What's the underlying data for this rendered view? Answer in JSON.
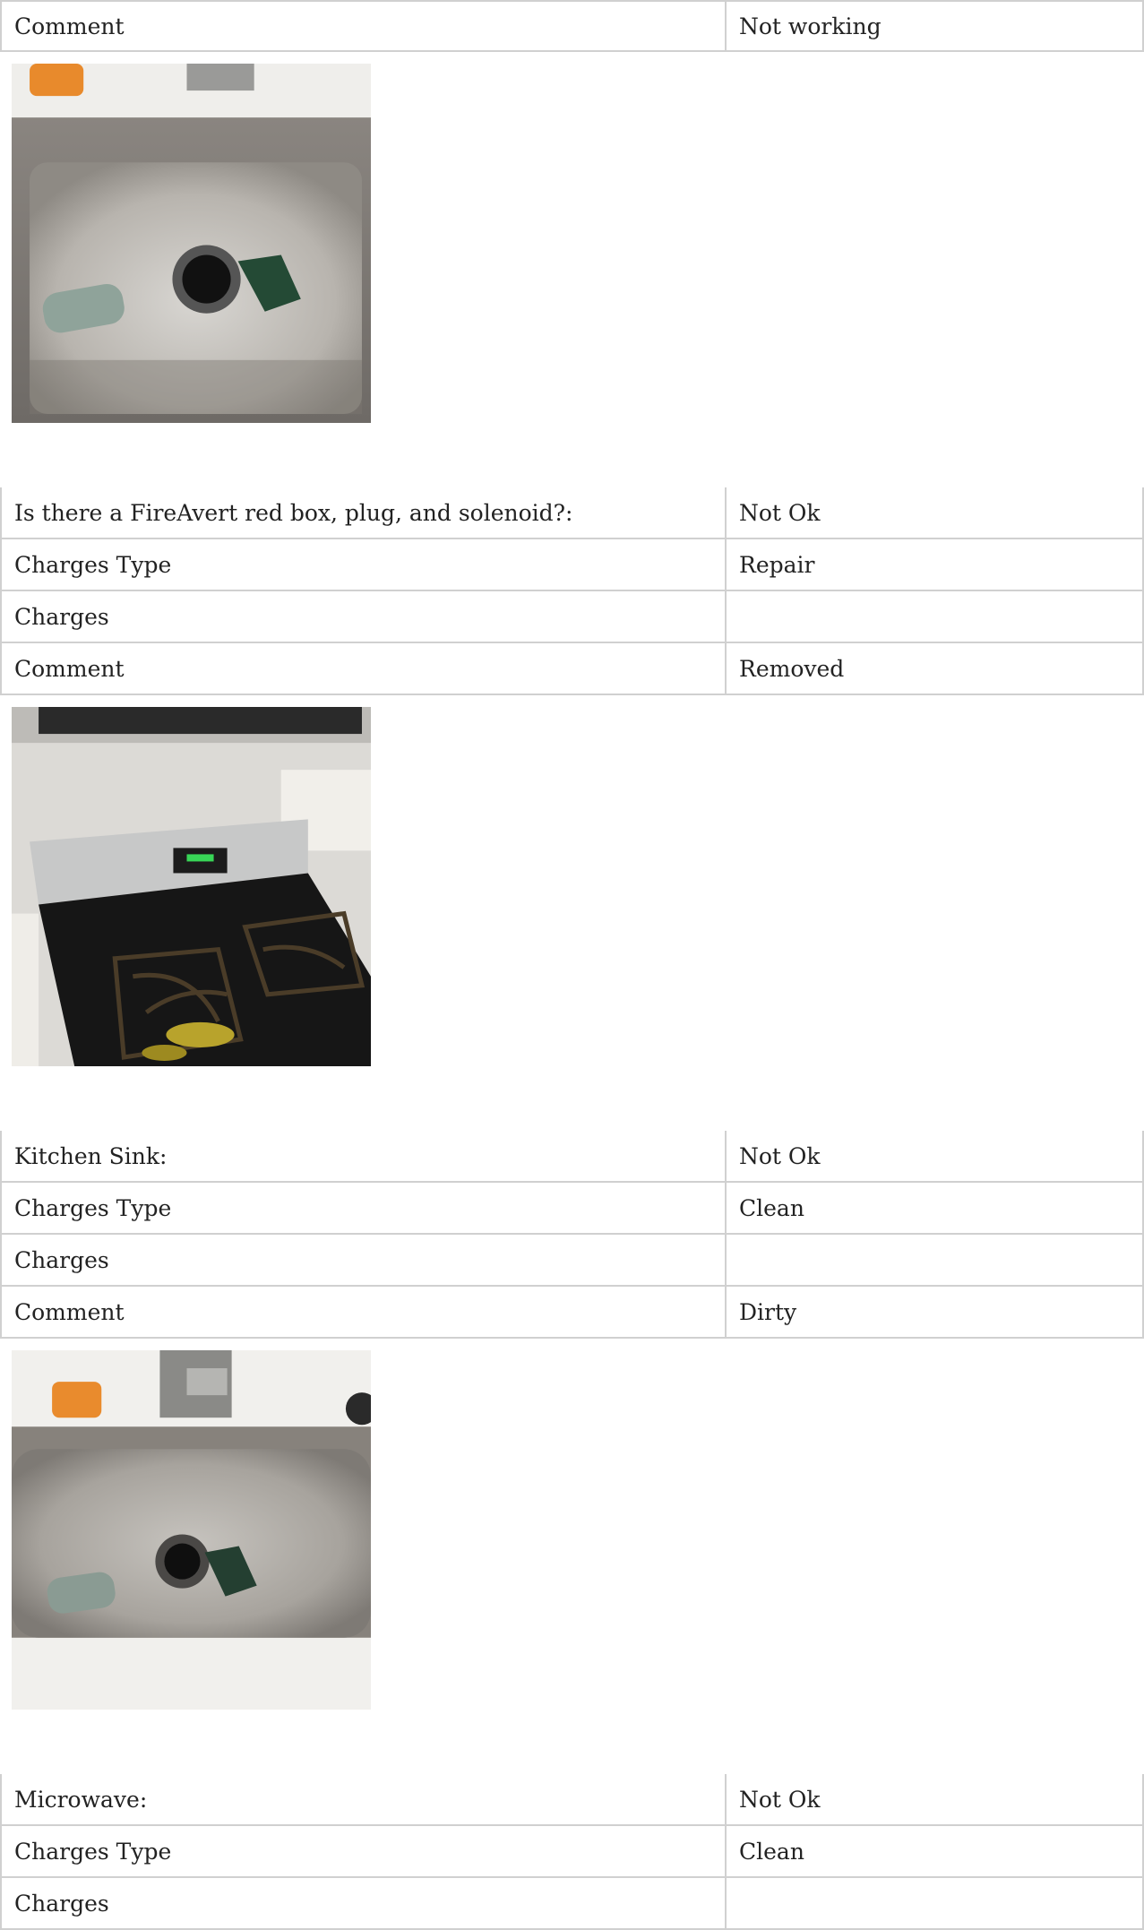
{
  "rows": {
    "r1": {
      "label": "Comment",
      "value": "Not working"
    },
    "r2": {
      "label": "Is there a FireAvert red box, plug, and solenoid?:",
      "value": "Not Ok"
    },
    "r3": {
      "label": "Charges Type",
      "value": "Repair"
    },
    "r4": {
      "label": "Charges",
      "value": ""
    },
    "r5": {
      "label": "Comment",
      "value": "Removed"
    },
    "r6": {
      "label": "Kitchen Sink:",
      "value": "Not Ok"
    },
    "r7": {
      "label": "Charges Type",
      "value": "Clean"
    },
    "r8": {
      "label": "Charges",
      "value": ""
    },
    "r9": {
      "label": "Comment",
      "value": "Dirty"
    },
    "r10": {
      "label": "Microwave:",
      "value": "Not Ok"
    },
    "r11": {
      "label": "Charges Type",
      "value": "Clean"
    },
    "r12": {
      "label": "Charges",
      "value": ""
    }
  }
}
